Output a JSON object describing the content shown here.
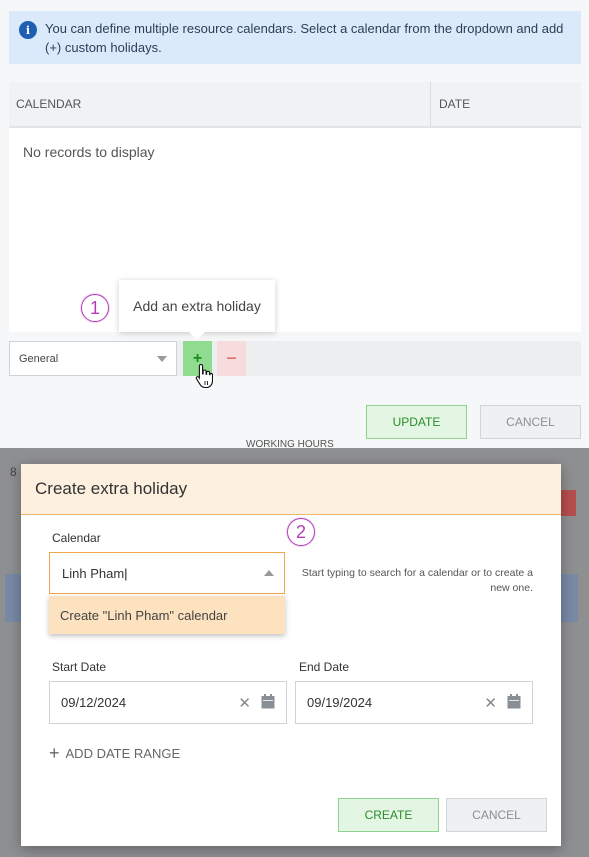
{
  "info": {
    "text": "You can define multiple resource calendars. Select a calendar from the dropdown and add (+) custom holidays."
  },
  "grid": {
    "columns": [
      "CALENDAR",
      "DATE"
    ],
    "empty_text": "No records to display"
  },
  "toolbar": {
    "calendar_value": "General",
    "add_label": "+",
    "remove_label": "−",
    "tooltip": "Add an extra holiday"
  },
  "markers": {
    "step1": "1",
    "step2": "2"
  },
  "top_actions": {
    "update": "UPDATE",
    "cancel": "CANCEL"
  },
  "background": {
    "working_hours": "WORKING HOURS",
    "left_digit": "8"
  },
  "dialog": {
    "title": "Create extra holiday",
    "calendar_label": "Calendar",
    "calendar_value": "Linh Pham",
    "hint": "Start typing to search for a calendar or to create a new one.",
    "suggestion": "Create \"Linh Pham\" calendar",
    "start_label": "Start Date",
    "start_value": "09/12/2024",
    "end_label": "End Date",
    "end_value": "09/19/2024",
    "add_range": "ADD DATE RANGE",
    "create": "CREATE",
    "cancel": "CANCEL"
  },
  "colors": {
    "info_bg": "#dbeafb",
    "add_green": "#8fdc8f",
    "marker": "#b43fb7",
    "dialog_header": "#fdf0df",
    "focus_orange": "#f0a64a"
  }
}
